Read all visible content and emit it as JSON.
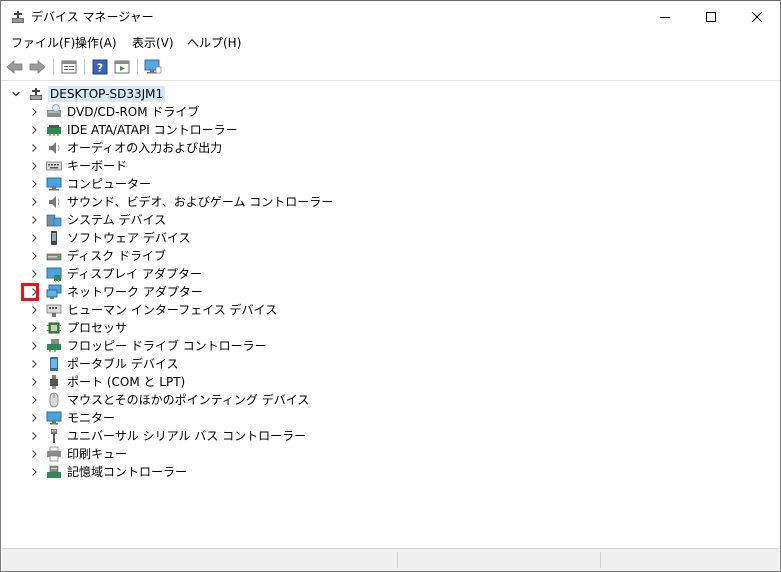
{
  "window": {
    "title": "デバイス マネージャー",
    "icon": "device-manager-icon"
  },
  "title_buttons": {
    "minimize": "minimize-icon",
    "maximize": "maximize-icon",
    "close": "close-icon"
  },
  "menu": [
    {
      "label": "ファイル(F)"
    },
    {
      "label": "操作(A)"
    },
    {
      "label": "表示(V)"
    },
    {
      "label": "ヘルプ(H)"
    }
  ],
  "toolbar": [
    {
      "icon": "back-arrow-icon"
    },
    {
      "icon": "forward-arrow-icon"
    },
    {
      "icon": "properties-icon"
    },
    {
      "icon": "help-icon"
    },
    {
      "icon": "run-icon"
    },
    {
      "icon": "monitor-scan-icon"
    }
  ],
  "tree": {
    "root": {
      "label": "DESKTOP-SD33JM1",
      "expanded": true
    },
    "items": [
      {
        "label": "DVD/CD-ROM ドライブ",
        "icon": "dvd-drive-icon"
      },
      {
        "label": "IDE ATA/ATAPI コントローラー",
        "icon": "ide-controller-icon"
      },
      {
        "label": "オーディオの入力および出力",
        "icon": "speaker-icon"
      },
      {
        "label": "キーボード",
        "icon": "keyboard-icon"
      },
      {
        "label": "コンピューター",
        "icon": "computer-icon"
      },
      {
        "label": "サウンド、ビデオ、およびゲーム コントローラー",
        "icon": "speaker-icon"
      },
      {
        "label": "システム デバイス",
        "icon": "system-device-icon"
      },
      {
        "label": "ソフトウェア デバイス",
        "icon": "software-device-icon"
      },
      {
        "label": "ディスク ドライブ",
        "icon": "disk-drive-icon"
      },
      {
        "label": "ディスプレイ アダプター",
        "icon": "display-adapter-icon"
      },
      {
        "label": "ネットワーク アダプター",
        "icon": "network-adapter-icon",
        "highlighted": true
      },
      {
        "label": "ヒューマン インターフェイス デバイス",
        "icon": "hid-icon"
      },
      {
        "label": "プロセッサ",
        "icon": "processor-icon"
      },
      {
        "label": "フロッピー ドライブ コントローラー",
        "icon": "floppy-controller-icon"
      },
      {
        "label": "ポータブル デバイス",
        "icon": "portable-device-icon"
      },
      {
        "label": "ポート (COM と LPT)",
        "icon": "port-icon"
      },
      {
        "label": "マウスとそのほかのポインティング デバイス",
        "icon": "mouse-icon"
      },
      {
        "label": "モニター",
        "icon": "monitor-icon"
      },
      {
        "label": "ユニバーサル シリアル バス コントローラー",
        "icon": "usb-icon"
      },
      {
        "label": "印刷キュー",
        "icon": "printer-icon"
      },
      {
        "label": "記憶域コントローラー",
        "icon": "storage-controller-icon"
      }
    ]
  },
  "colors": {
    "highlight_box": "#e8141a",
    "root_selection": "#d9e8f6"
  }
}
